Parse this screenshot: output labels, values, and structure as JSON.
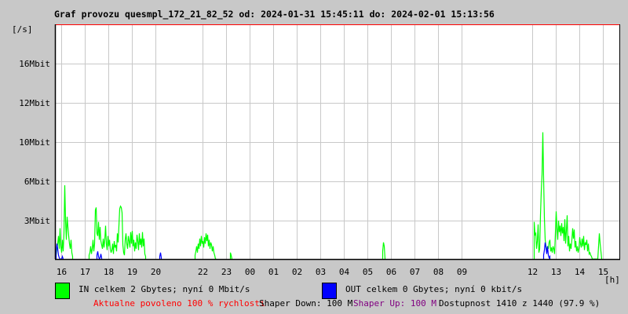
{
  "title": "Graf provozu quesmpl_172_21_82_52 od: 2024-01-31 15:45:11 do: 2024-02-01 15:13:56",
  "legend": {
    "in_label": "IN celkem 2 Gbytes; nyní 0 Mbit/s",
    "out_label": "OUT celkem 0 Gbytes; nyní 0 kbit/s",
    "in_color": "#00ff00",
    "out_color": "#0000ff"
  },
  "footer": {
    "allowed": "Aktualne povoleno 100 % rychlosti",
    "shaper_down": "Shaper Down: 100 M",
    "shaper_up": "Shaper Up: 100 M",
    "availability": "Dostupnost 1410 z 1440 (97.9 %)",
    "allowed_color": "#ff0000",
    "shaper_up_color": "#800080"
  },
  "chart_data": {
    "type": "line",
    "title": "Graf provozu quesmpl_172_21_82_52 od: 2024-01-31 15:45:11 do: 2024-02-01 15:13:56",
    "ylabel": "[/s]",
    "xlabel": "[h]",
    "y_ticks": [
      {
        "label": "3Mbit",
        "value": 3
      },
      {
        "label": "6Mbit",
        "value": 6
      },
      {
        "label": "10Mbit",
        "value": 10
      },
      {
        "label": "12Mbit",
        "value": 12
      },
      {
        "label": "16Mbit",
        "value": 16
      }
    ],
    "x_ticks": [
      {
        "label": "16",
        "min": 0
      },
      {
        "label": "17",
        "min": 60
      },
      {
        "label": "18",
        "min": 120
      },
      {
        "label": "19",
        "min": 180
      },
      {
        "label": "20",
        "min": 240
      },
      {
        "label": "22",
        "min": 360
      },
      {
        "label": "23",
        "min": 420
      },
      {
        "label": "00",
        "min": 480
      },
      {
        "label": "01",
        "min": 540
      },
      {
        "label": "02",
        "min": 600
      },
      {
        "label": "03",
        "min": 660
      },
      {
        "label": "04",
        "min": 720
      },
      {
        "label": "05",
        "min": 780
      },
      {
        "label": "06",
        "min": 840
      },
      {
        "label": "07",
        "min": 900
      },
      {
        "label": "08",
        "min": 960
      },
      {
        "label": "09",
        "min": 1020
      },
      {
        "label": "12",
        "min": 1200
      },
      {
        "label": "13",
        "min": 1260
      },
      {
        "label": "14",
        "min": 1320
      },
      {
        "label": "15",
        "min": 1380
      }
    ],
    "grid": true,
    "step_minutes": 2,
    "series": [
      {
        "name": "IN",
        "unit": "Mbit/s",
        "color": "#00ff00",
        "segments": [
          {
            "start_min": -14,
            "values": [
              0.3,
              0.8,
              1.2,
              1.8,
              0.8,
              2.4,
              1.0,
              0.5,
              1.5,
              0.6,
              2.0,
              5.7,
              3.0,
              1.5,
              3.3,
              2.5,
              1.8,
              1.2,
              0.8,
              1.5,
              0.5,
              0.2
            ]
          },
          {
            "start_min": 70,
            "values": [
              0.3,
              0.5,
              1.0,
              0.4,
              0.8,
              1.5,
              0.6,
              1.2,
              3.8,
              4.0,
              2.0,
              1.8,
              2.9,
              1.5,
              2.5,
              1.4,
              1.1,
              0.8,
              1.6,
              0.9,
              1.5,
              2.6,
              1.2,
              0.7,
              1.8,
              1.0,
              1.5,
              0.8,
              0.5,
              0.7,
              1.2,
              0.4,
              1.4,
              0.9,
              1.1,
              0.6,
              2.0,
              1.3,
              2.6,
              3.9,
              4.1,
              4.0,
              3.6,
              1.1,
              0.5,
              0.3,
              1.5,
              2.0,
              1.2,
              0.8,
              1.8,
              1.4,
              0.9,
              2.1,
              1.2,
              2.2,
              1.0,
              1.5,
              0.6,
              1.3,
              0.8,
              1.9,
              1.4,
              0.7,
              2.0,
              1.1,
              1.6,
              0.9,
              2.1,
              1.0,
              1.6,
              0.4,
              0.2
            ]
          },
          {
            "start_min": 340,
            "values": [
              0.3,
              0.6,
              1.0,
              0.5,
              1.2,
              0.8,
              1.6,
              1.0,
              1.8,
              1.2,
              1.4,
              0.9,
              1.7,
              1.2,
              2.0,
              1.4,
              1.9,
              1.0,
              1.5,
              0.8,
              1.3,
              1.1,
              0.6,
              1.0,
              0.5,
              0.3,
              0,
              0
            ]
          },
          {
            "start_min": 430,
            "values": [
              0.5,
              0.3,
              0
            ]
          },
          {
            "start_min": 818,
            "values": [
              0.6,
              1.3,
              1.0,
              0
            ]
          },
          {
            "start_min": 1204,
            "values": [
              2.9,
              1.9,
              2.0,
              0.8,
              1.4,
              2.7,
              0.5,
              0.8,
              3.4,
              5.2,
              6.7,
              10.5,
              6.3,
              3.2,
              1.5,
              1.0,
              0.5,
              1.0,
              0.8,
              1.3,
              1.5,
              0.6,
              0.9,
              0.5,
              1.0,
              0.8,
              0.4,
              2.0,
              3.7,
              2.4,
              1.5,
              3.0,
              2.1,
              2.6,
              1.8,
              2.8,
              2.0,
              2.5,
              1.4,
              3.1,
              1.2,
              2.2,
              3.4,
              1.0,
              1.8,
              0.6,
              1.2,
              0.8,
              1.5,
              2.4,
              1.6,
              2.3,
              0.9,
              1.4,
              0.6,
              1.0,
              0.5,
              0.8,
              1.7,
              1.2,
              0.9,
              1.6,
              1.0,
              1.8,
              0.7,
              1.3,
              1.1,
              1.5,
              0.6,
              1.2,
              0.4,
              0.5,
              0.3,
              0.2,
              0,
              0,
              0,
              0,
              0,
              0,
              0,
              0,
              1.0,
              2.0,
              1.2,
              0.6,
              0
            ]
          }
        ]
      },
      {
        "name": "OUT",
        "unit": "kbit/s",
        "color": "#0000ff",
        "segments": [
          {
            "start_min": -14,
            "values": [
              0.4,
              1.2,
              0.8,
              0.3,
              0.1,
              0,
              0,
              0,
              0.2,
              0
            ]
          },
          {
            "start_min": 90,
            "values": [
              0.3,
              0.6,
              0.2,
              0,
              0.1,
              0.4,
              0.1
            ]
          },
          {
            "start_min": 250,
            "values": [
              0.2,
              0.5,
              0.1
            ]
          },
          {
            "start_min": 1228,
            "values": [
              0.3,
              0.7,
              1.3,
              0.9,
              0.4,
              1.0,
              0.3,
              0.1,
              0.2
            ]
          }
        ]
      }
    ]
  }
}
